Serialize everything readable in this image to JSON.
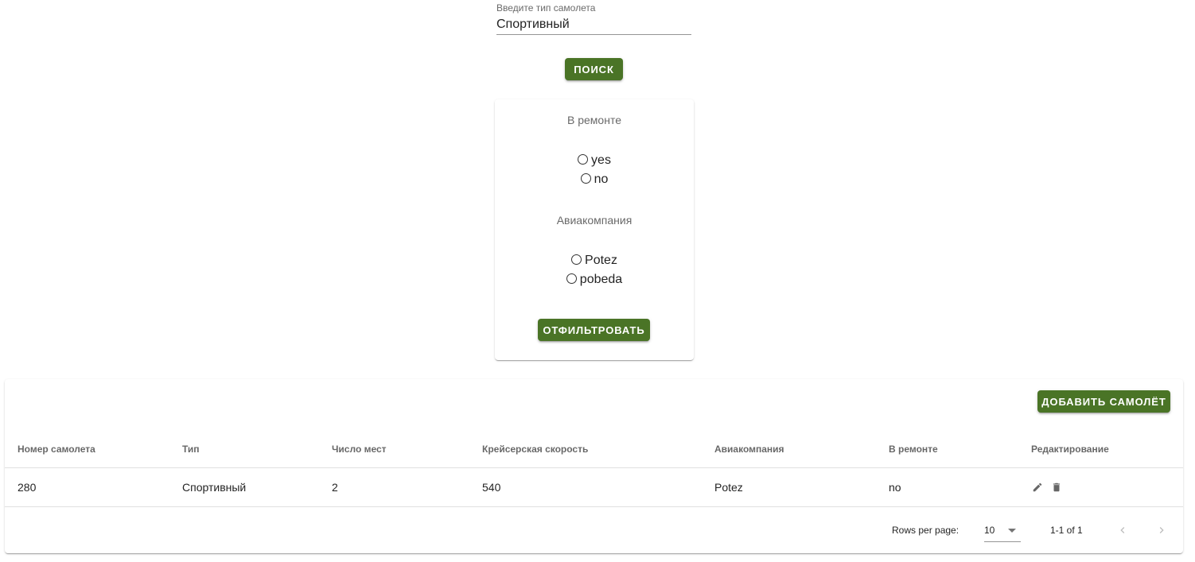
{
  "search": {
    "label": "Введите тип самолета",
    "value": "Спортивный",
    "button_label": "Поиск"
  },
  "filter": {
    "repair_heading": "В ремонте",
    "repair_options": [
      "yes",
      "no"
    ],
    "airline_heading": "Авиакомпания",
    "airline_options": [
      "Potez",
      "pobeda"
    ],
    "button_label": "Отфильтровать"
  },
  "table": {
    "add_button_label": "Добавить самолёт",
    "columns": [
      "Номер самолета",
      "Тип",
      "Число мест",
      "Крейсерская скорость",
      "Авиакомпания",
      "В ремонте",
      "Редактирование"
    ],
    "rows": [
      [
        "280",
        "Спортивный",
        "2",
        "540",
        "Potez",
        "no"
      ]
    ],
    "row_icons": [
      "pencil-icon",
      "trash-icon"
    ],
    "footer": {
      "rows_per_page_label": "Rows per page:",
      "rows_per_page_value": "10",
      "page_info": "1-1 of 1"
    }
  },
  "colors": {
    "accent": "#4a7426"
  }
}
